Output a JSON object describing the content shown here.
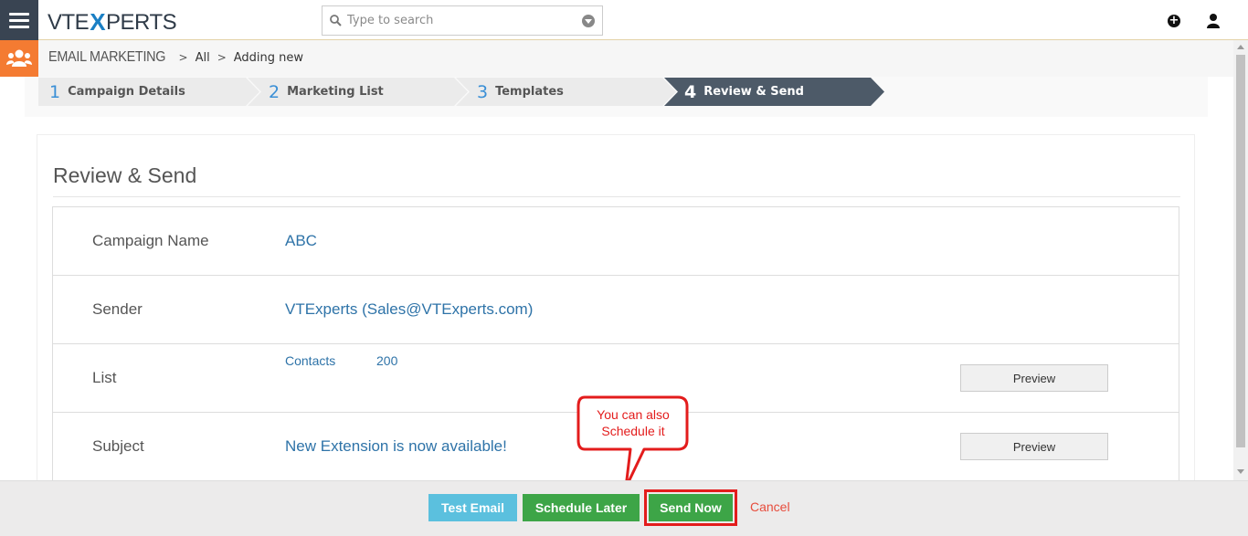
{
  "header": {
    "logo_left": "VTE",
    "logo_x": "X",
    "logo_right": "PERTS",
    "search_placeholder": "Type to search"
  },
  "breadcrumb": {
    "module": "EMAIL MARKETING",
    "items": [
      "All",
      "Adding new"
    ]
  },
  "steps": [
    {
      "num": "1",
      "label": "Campaign Details",
      "active": false
    },
    {
      "num": "2",
      "label": "Marketing List",
      "active": false
    },
    {
      "num": "3",
      "label": "Templates",
      "active": false
    },
    {
      "num": "4",
      "label": "Review & Send",
      "active": true
    }
  ],
  "review": {
    "title": "Review & Send",
    "rows": {
      "campaign_name": {
        "label": "Campaign Name",
        "value": "ABC"
      },
      "sender": {
        "label": "Sender",
        "value": "VTExperts (Sales@VTExperts.com)"
      },
      "list": {
        "label": "List",
        "list_name": "Contacts",
        "count": "200",
        "preview": "Preview"
      },
      "subject": {
        "label": "Subject",
        "value": "New Extension is now available!",
        "preview": "Preview"
      }
    }
  },
  "footer": {
    "test_email": "Test Email",
    "schedule_later": "Schedule Later",
    "send_now": "Send Now",
    "cancel": "Cancel"
  },
  "callout": {
    "line1": "You can also",
    "line2": "Schedule it"
  },
  "colors": {
    "accent": "#3a8fd6",
    "module_orange": "#f47b32",
    "active_step": "#4d5a68",
    "green": "#3da547",
    "info": "#5bc0de",
    "annotation_red": "#e31c1c"
  }
}
